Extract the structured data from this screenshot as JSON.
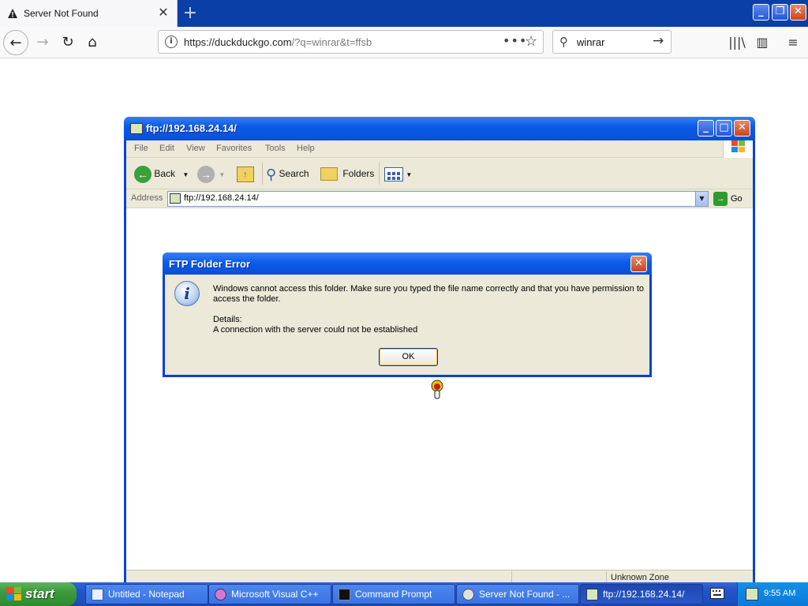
{
  "browser": {
    "tab_title": "Server Not Found",
    "url_host": "https://duckduckgo.com",
    "url_path": "/?q=winrar&t=ffsb",
    "search_query": "winrar"
  },
  "explorer": {
    "title": "ftp://192.168.24.14/",
    "menu": [
      "File",
      "Edit",
      "View",
      "Favorites",
      "Tools",
      "Help"
    ],
    "toolbar": {
      "back": "Back",
      "search": "Search",
      "folders": "Folders"
    },
    "address_label": "Address",
    "address_value": "ftp://192.168.24.14/",
    "go_label": "Go",
    "status_zone": "Unknown Zone"
  },
  "dialog": {
    "title": "FTP Folder Error",
    "message": "Windows cannot access this folder. Make sure you typed the file name correctly and that you have permission to access the folder.",
    "details_label": "Details:",
    "details_text": "A connection with the server could not be established",
    "ok_label": "OK"
  },
  "taskbar": {
    "start_label": "start",
    "tasks": [
      {
        "label": "Untitled - Notepad"
      },
      {
        "label": "Microsoft Visual C++"
      },
      {
        "label": "Command Prompt"
      },
      {
        "label": "Server Not Found - ..."
      },
      {
        "label": "ftp://192.168.24.14/"
      }
    ],
    "clock": "9:55 AM"
  },
  "colors": {
    "xp_title_blue": "#0a5be8",
    "taskbar_blue": "#2456c8",
    "start_green": "#3c9a3c",
    "dialog_face": "#ece9d8"
  }
}
